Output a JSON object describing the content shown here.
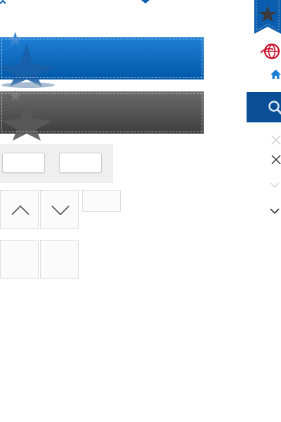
{
  "colors": {
    "brand_blue": "#0a5cae",
    "brand_gray": "#4a4a4a",
    "logo_red": "#c8102e",
    "tile_bg": "#fbfbfb",
    "panel_bg": "#efefef"
  },
  "icons": {
    "ribbon": "star-ribbon-icon",
    "logo": "basketball-logo-icon",
    "home": "home-icon",
    "search": "search-icon",
    "close_light": "close-icon",
    "close_dark": "close-icon",
    "chevron_light": "chevron-down-icon",
    "chevron_dark": "chevron-down-icon",
    "up_arrow": "chevron-up-icon",
    "down_arrow": "chevron-down-icon"
  },
  "buttons": {
    "left_label": "",
    "right_label": ""
  }
}
